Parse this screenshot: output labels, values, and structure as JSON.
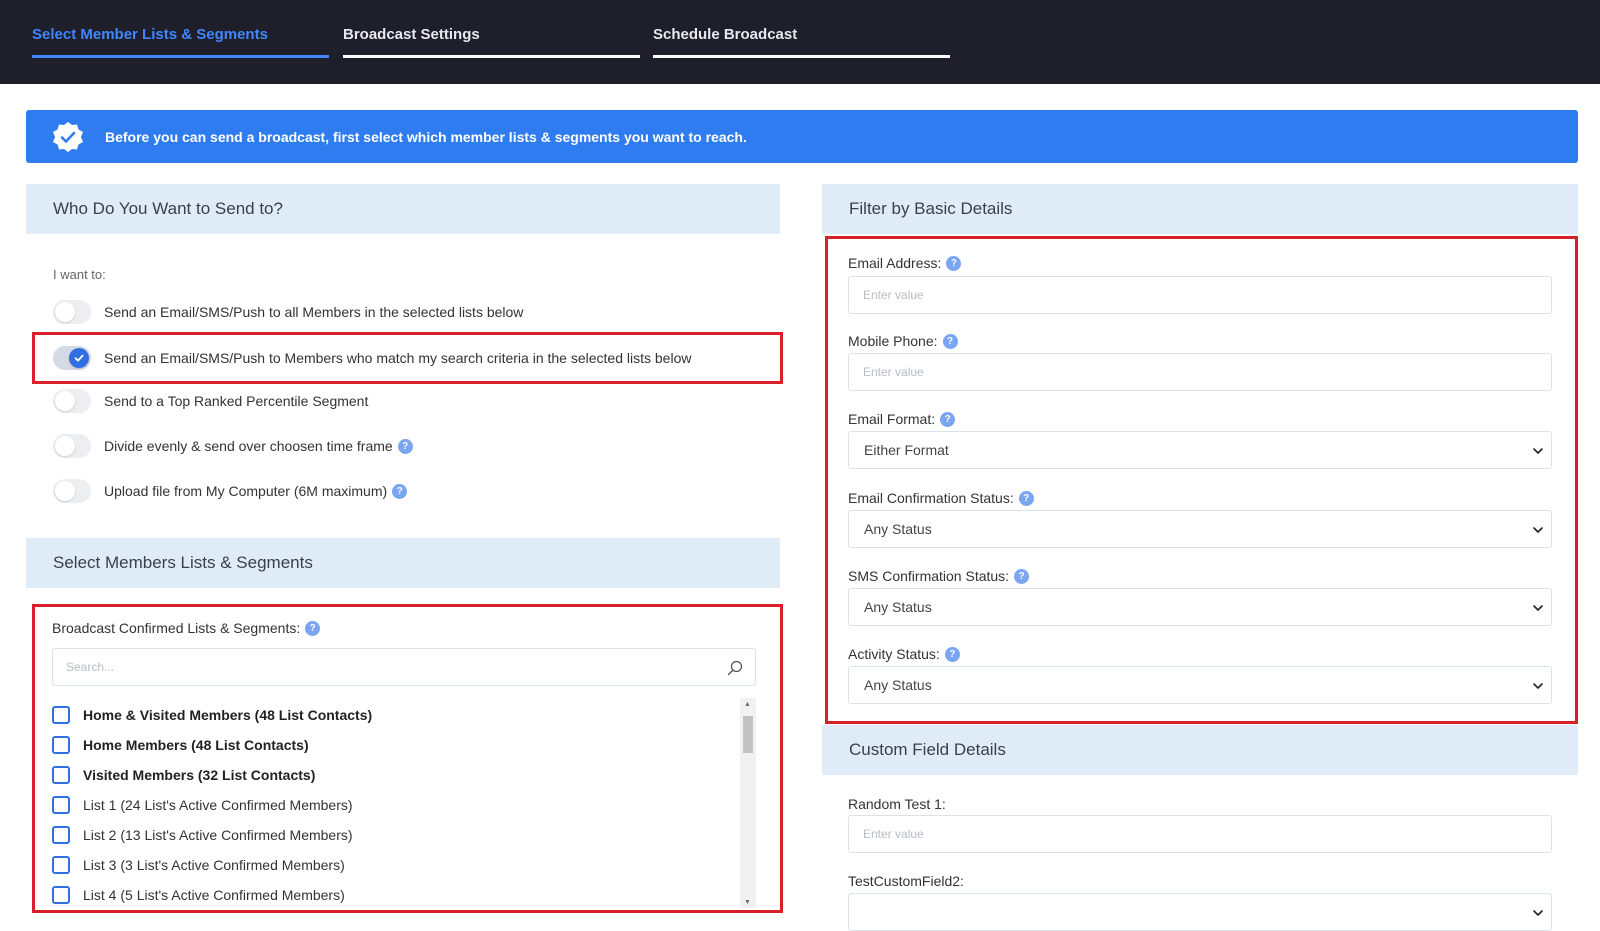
{
  "tabs": [
    {
      "label": "Select Member Lists & Segments"
    },
    {
      "label": "Broadcast Settings"
    },
    {
      "label": "Schedule Broadcast"
    }
  ],
  "banner": {
    "text": "Before you can send a broadcast, first select which member lists & segments you want to reach."
  },
  "send_panel": {
    "title": "Who Do You Want to Send to?",
    "prompt": "I want to:",
    "options": [
      {
        "label": "Send an Email/SMS/Push to all Members in the selected lists below",
        "enabled": false
      },
      {
        "label": "Send an Email/SMS/Push to Members who match my search criteria in the selected lists below",
        "enabled": true
      },
      {
        "label": "Send to a Top Ranked Percentile Segment",
        "enabled": false
      },
      {
        "label": "Divide evenly & send over choosen time frame",
        "enabled": false
      },
      {
        "label": "Upload file from My Computer (6M maximum)",
        "enabled": false
      }
    ]
  },
  "lists_panel": {
    "title": "Select Members Lists & Segments",
    "field_label": "Broadcast Confirmed Lists & Segments:",
    "search_placeholder": "Search...",
    "items": [
      {
        "label": "Home & Visited Members (48 List Contacts)"
      },
      {
        "label": "Home Members (48 List Contacts)"
      },
      {
        "label": "Visited Members (32 List Contacts)"
      },
      {
        "label": "List 1 (24 List's Active Confirmed Members)"
      },
      {
        "label": "List 2 (13 List's Active Confirmed Members)"
      },
      {
        "label": "List 3 (3 List's Active Confirmed Members)"
      },
      {
        "label": "List 4 (5 List's Active Confirmed Members)"
      }
    ]
  },
  "filter_panel": {
    "title": "Filter by Basic Details",
    "email_label": "Email Address:",
    "email_placeholder": "Enter value",
    "mobile_label": "Mobile Phone:",
    "mobile_placeholder": "Enter value",
    "format_label": "Email Format:",
    "format_value": "Either Format",
    "email_conf_label": "Email Confirmation Status:",
    "email_conf_value": "Any Status",
    "sms_conf_label": "SMS Confirmation Status:",
    "sms_conf_value": "Any Status",
    "activity_label": "Activity Status:",
    "activity_value": "Any Status"
  },
  "custom_panel": {
    "title": "Custom Field Details",
    "field1_label": "Random Test 1:",
    "field1_placeholder": "Enter value",
    "field2_label": "TestCustomField2:"
  },
  "help_glyph": "?",
  "colors": {
    "accent": "#2f7cf0",
    "highlight": "#d9202a",
    "topbar": "#1f1f2c",
    "panel_header": "#dfecf7"
  }
}
